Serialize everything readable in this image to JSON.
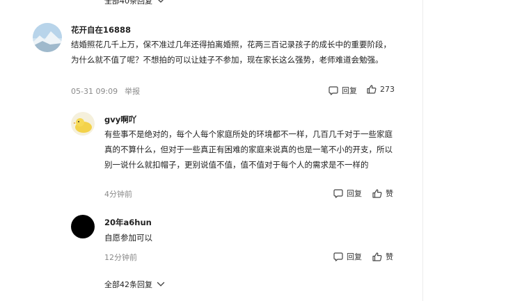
{
  "top_expand": {
    "label": "全部40条回复"
  },
  "main_comment": {
    "username": "花开自在16888",
    "text": "结婚照花几千上万，保不准过几年还得拍离婚照，花两三百记录孩子的成长中的重要阶段，为什么就不值了呢？不想拍的可以让娃子不参加，现在家长这么强势，老师难道会勉强。",
    "time": "05-31 09:09",
    "report_label": "举报",
    "reply_label": "回复",
    "like_count": "273"
  },
  "replies": [
    {
      "username": "gvy啊吖",
      "text": "有些事不是绝对的，每个人每个家庭所处的环境都不一样，几百几千对于一些家庭真的不算什么，但对于一些真正有困难的家庭来说真的也是一笔不小的开支，所以别一说什么就扣帽子，更别说值不值，值不值对于每个人的需求是不一样的",
      "time": "4分钟前",
      "reply_label": "回复",
      "like_label": "赞"
    },
    {
      "username": "20年a6hun",
      "text": "自愿参加可以",
      "time": "12分钟前",
      "reply_label": "回复",
      "like_label": "赞"
    }
  ],
  "bottom_expand": {
    "label": "全部42条回复"
  },
  "icons": {
    "reply": "comment-icon",
    "like": "thumbs-up-icon",
    "expand": "chevron-down-icon"
  }
}
